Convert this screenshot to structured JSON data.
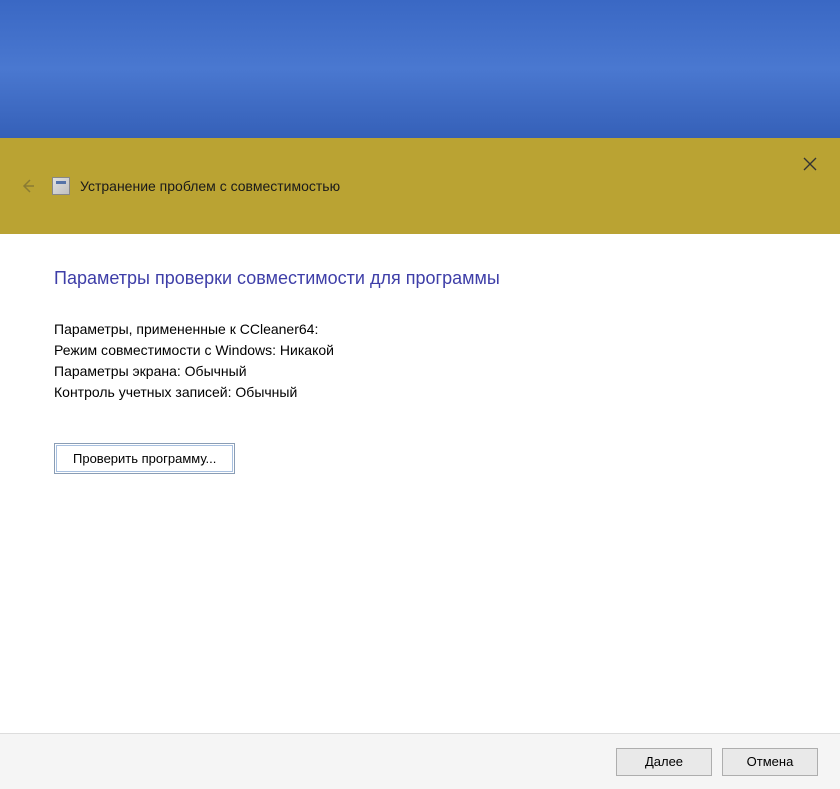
{
  "header": {
    "title": "Устранение проблем с совместимостью"
  },
  "main": {
    "heading": "Параметры проверки совместимости для программы",
    "line1": "Параметры, примененные к  CCleaner64:",
    "line2": "Режим совместимости с Windows: Никакой",
    "line3": "Параметры экрана:  Обычный",
    "line4": "Контроль учетных записей:  Обычный",
    "test_button": "Проверить программу..."
  },
  "footer": {
    "next": "Далее",
    "cancel": "Отмена"
  }
}
